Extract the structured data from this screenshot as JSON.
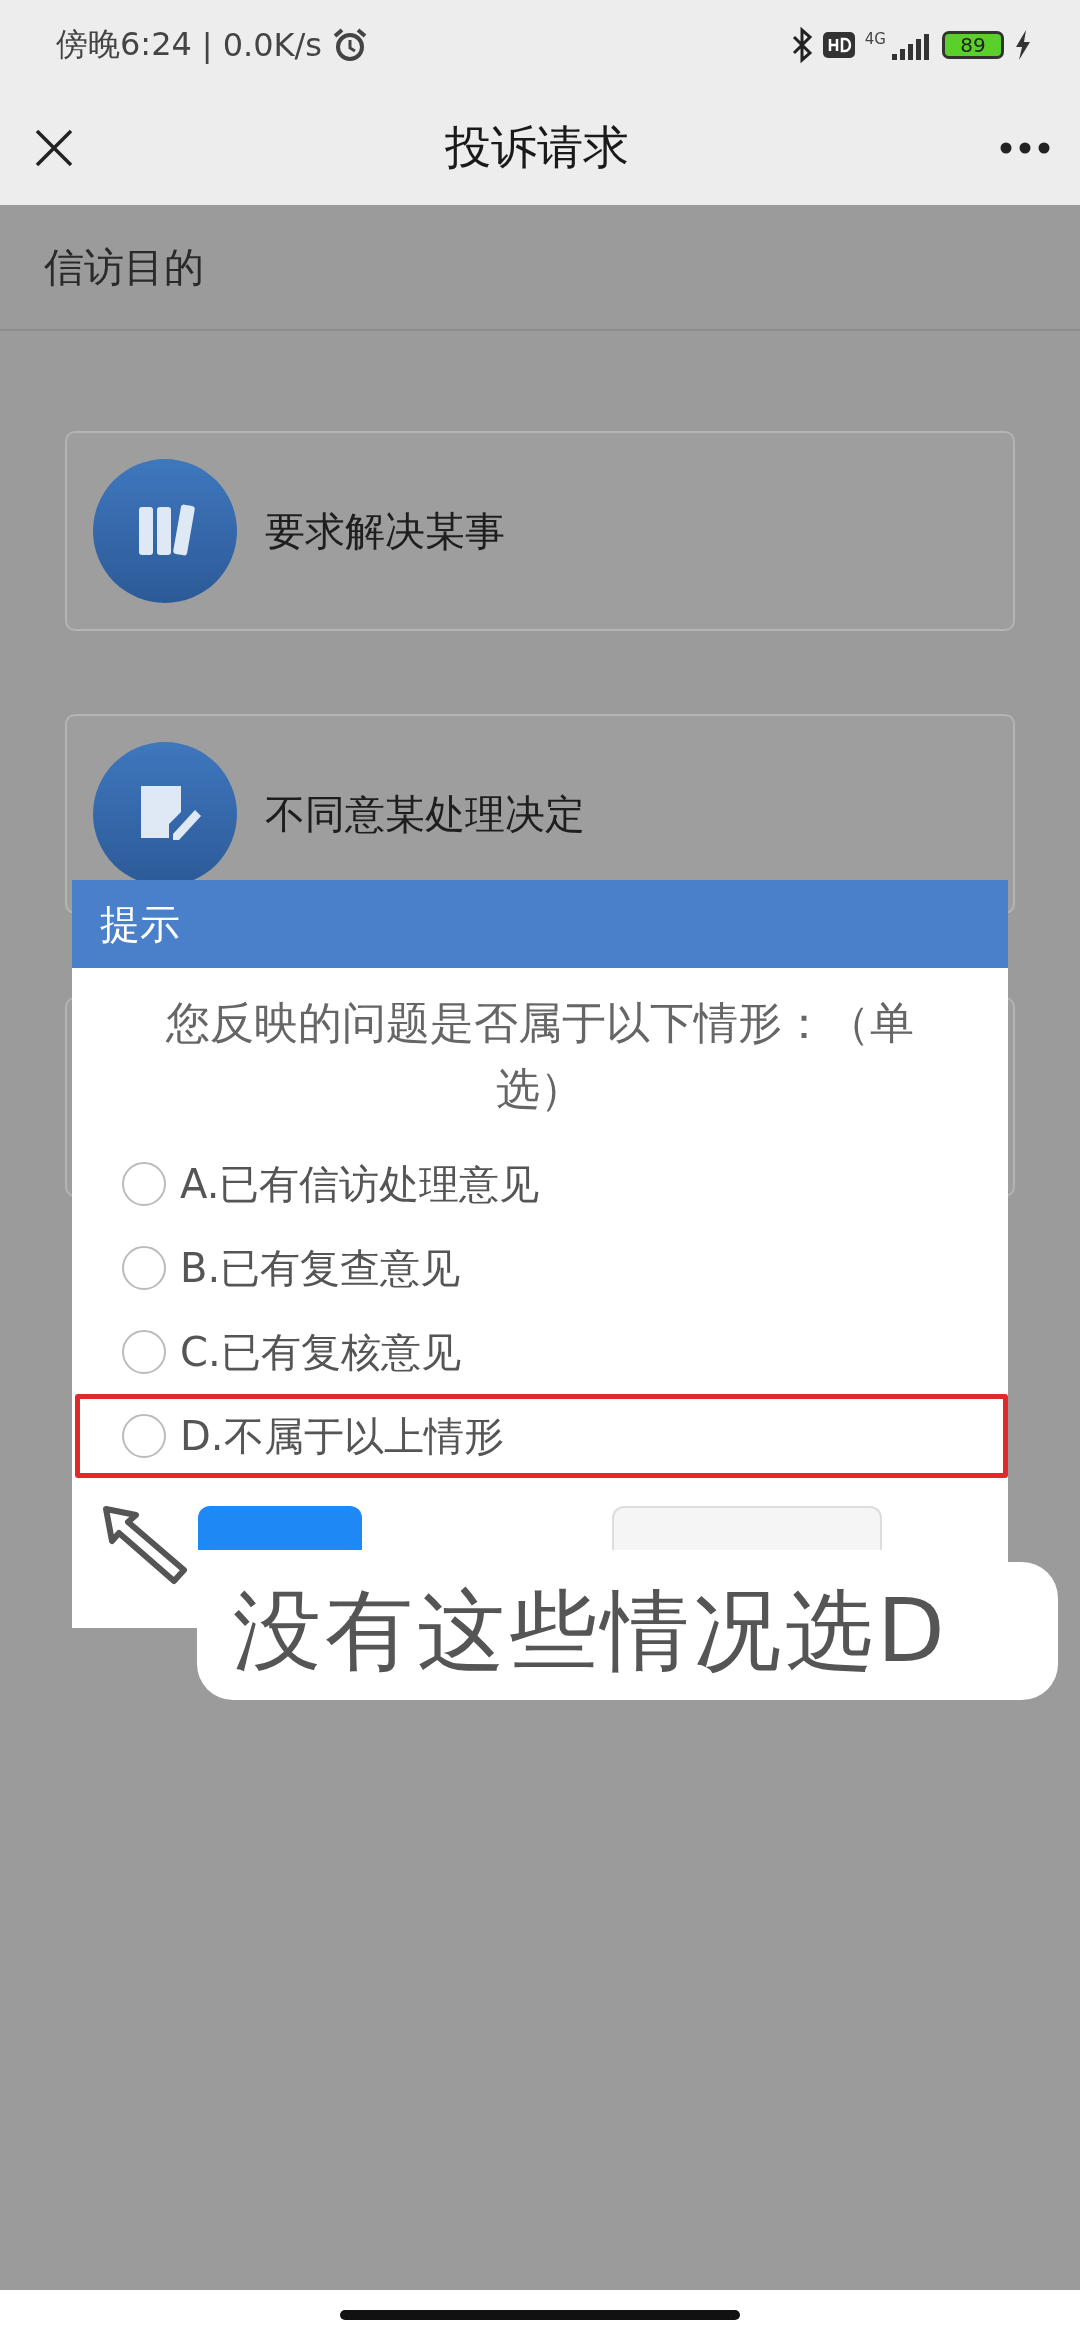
{
  "status_bar": {
    "time": "傍晚6:24",
    "separator": "|",
    "speed": "0.0K/s",
    "network": "4G",
    "battery": "89"
  },
  "nav": {
    "title": "投诉请求"
  },
  "section": {
    "label": "信访目的"
  },
  "cards": [
    {
      "label": "要求解决某事"
    },
    {
      "label": "不同意某处理决定"
    }
  ],
  "dialog": {
    "title": "提示",
    "question": "您反映的问题是否属于以下情形：（单选）",
    "options": [
      {
        "label": "A.已有信访处理意见",
        "selected": false,
        "highlighted": false
      },
      {
        "label": "B.已有复查意见",
        "selected": false,
        "highlighted": false
      },
      {
        "label": "C.已有复核意见",
        "selected": false,
        "highlighted": false
      },
      {
        "label": "D.不属于以上情形",
        "selected": false,
        "highlighted": true
      }
    ],
    "buttons": [
      {
        "kind": "primary"
      },
      {
        "kind": "secondary"
      }
    ]
  },
  "annotation": {
    "caption": "没有这些情况选D"
  }
}
